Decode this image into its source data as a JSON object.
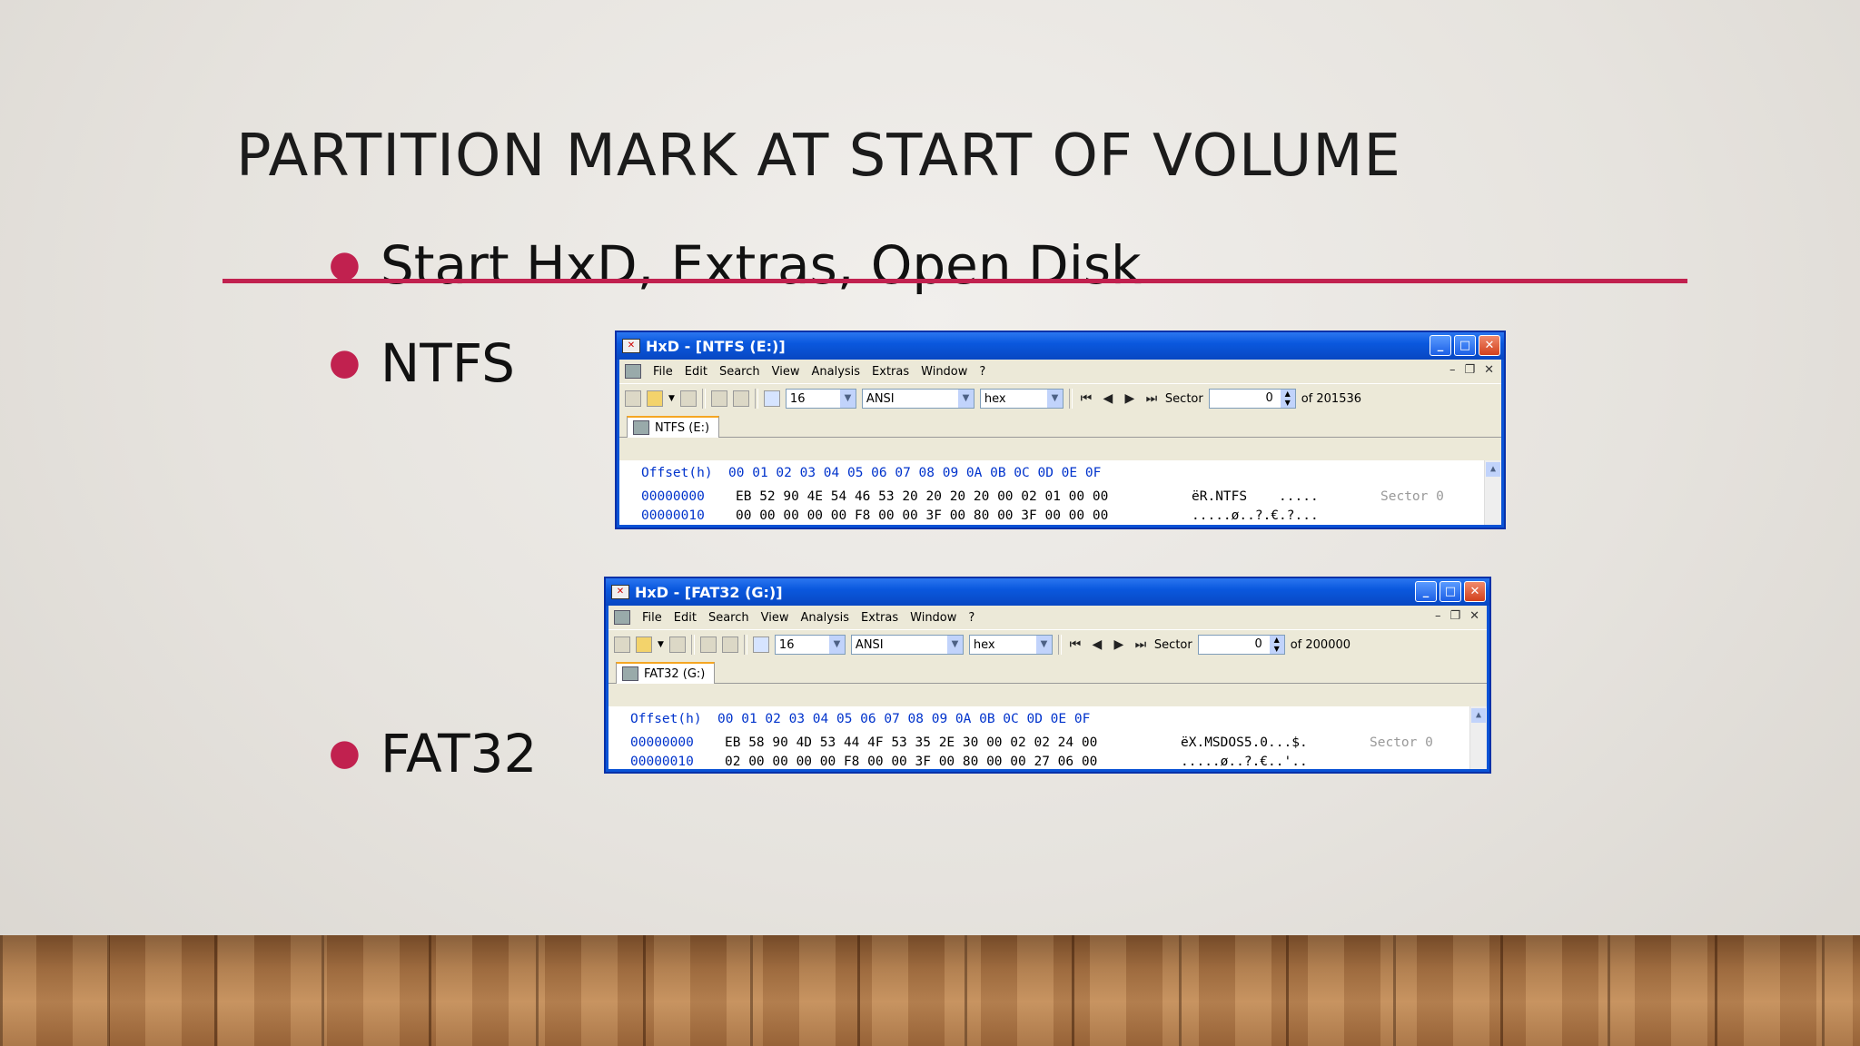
{
  "slide": {
    "title": "PARTITION MARK AT START OF VOLUME",
    "bullets": [
      {
        "text": "Start HxD, Extras, Open Disk"
      },
      {
        "text": "NTFS"
      },
      {
        "text": "FAT32"
      }
    ],
    "accent_color": "#c1214f"
  },
  "menu": [
    "File",
    "Edit",
    "Search",
    "View",
    "Analysis",
    "Extras",
    "Window",
    "?"
  ],
  "toolbar_common": {
    "bytes_per_row": "16",
    "charset": "ANSI",
    "offset_base": "hex",
    "sector_label": "Sector"
  },
  "windows": [
    {
      "title": "HxD - [NTFS (E:)]",
      "tab": "NTFS (E:)",
      "sector_value": "0",
      "sector_total": "of 201536",
      "header": "Offset(h)  00 01 02 03 04 05 06 07 08 09 0A 0B 0C 0D 0E 0F",
      "rows": [
        {
          "offset": "00000000",
          "bytes": "EB 52 90 4E 54 46 53 20 20 20 20 00 02 01 00 00",
          "ascii": "ëR.NTFS    .....",
          "info": "Sector 0"
        },
        {
          "offset": "00000010",
          "bytes": "00 00 00 00 00 F8 00 00 3F 00 80 00 3F 00 00 00",
          "ascii": ".....ø..?.€.?...",
          "info": ""
        }
      ]
    },
    {
      "title": "HxD - [FAT32 (G:)]",
      "tab": "FAT32 (G:)",
      "sector_value": "0",
      "sector_total": "of 200000",
      "header": "Offset(h)  00 01 02 03 04 05 06 07 08 09 0A 0B 0C 0D 0E 0F",
      "rows": [
        {
          "offset": "00000000",
          "bytes": "EB 58 90 4D 53 44 4F 53 35 2E 30 00 02 02 24 00",
          "ascii": "ëX.MSDOS5.0...$.",
          "info": "Sector 0"
        },
        {
          "offset": "00000010",
          "bytes": "02 00 00 00 00 F8 00 00 3F 00 80 00 00 27 06 00",
          "ascii": ".....ø..?.€..'..",
          "info": ""
        }
      ]
    }
  ]
}
